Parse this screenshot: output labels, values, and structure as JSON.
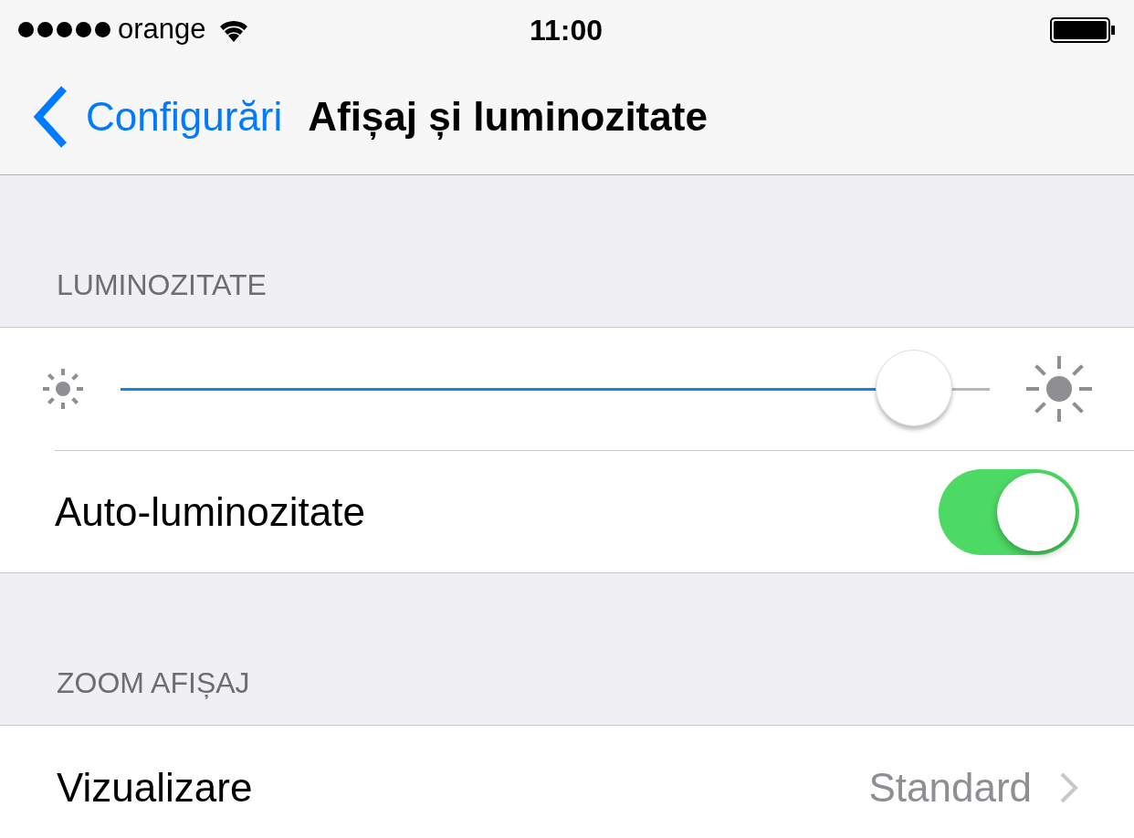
{
  "status_bar": {
    "carrier": "orange",
    "time": "11:00"
  },
  "nav": {
    "back": "Configurări",
    "title": "Afișaj și luminozitate"
  },
  "sections": [
    {
      "header": "LUMINOZITATE",
      "rows": [
        {
          "kind": "slider",
          "level": 0.955
        },
        {
          "kind": "toggle",
          "label": "Auto-luminozitate",
          "on": true
        }
      ]
    },
    {
      "header": "ZOOM AFIȘAJ",
      "rows": [
        {
          "kind": "detail",
          "label": "Vizualizare",
          "value": "Standard"
        }
      ]
    }
  ]
}
